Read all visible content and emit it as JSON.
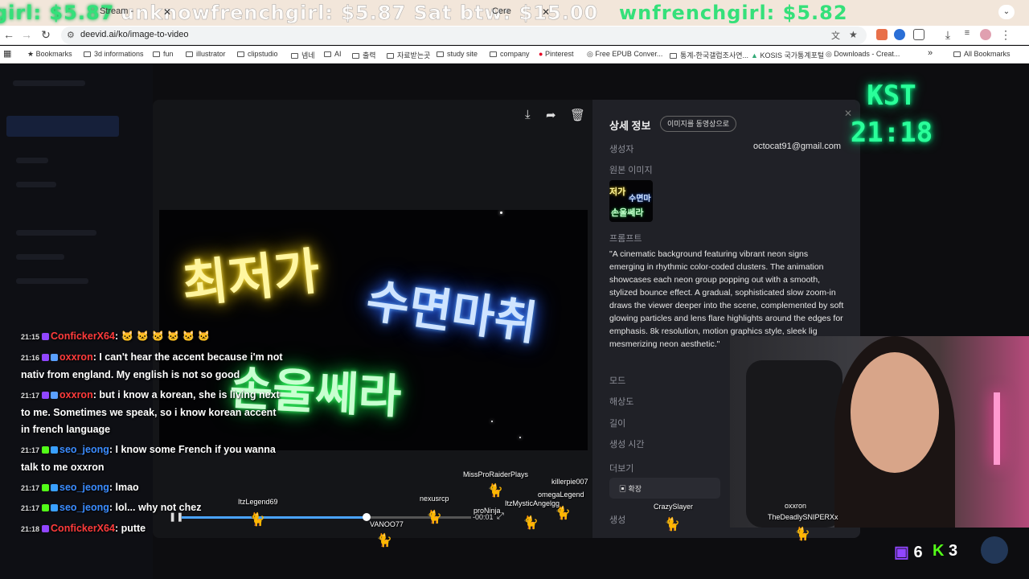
{
  "tabstrip": {
    "ticker_1": "girl: $5.87",
    "ticker_2": "unknowfrenchgirl: $5.87 Sat btw: $15.00",
    "ticker_3": "wnfrenchgirl: $5.82",
    "tab_fragments": [
      "Stream -",
      "Cere"
    ]
  },
  "address_bar": {
    "url": "deevid.ai/ko/image-to-video"
  },
  "bookmarks": [
    "Bookmarks",
    "3d informations",
    "fun",
    "illustrator",
    "clipstudio",
    "넴네",
    "AI",
    "출력",
    "자료받는곳",
    "study site",
    "company",
    "Pinterest",
    "Free EPUB Conver...",
    "통계-한국갤럽조사연...",
    "KOSIS 국가통계포털",
    "Downloads - Creat...",
    "All Bookmarks"
  ],
  "video": {
    "neon_1": "최저가",
    "neon_2": "수면마취",
    "neon_3": "손울쎄라",
    "time_remaining": "-00:01"
  },
  "details": {
    "title": "상세 정보",
    "convert_button": "이미지를 동영상으로",
    "creator_label": "생성자",
    "creator_value": "octocat91@gmail.com",
    "source_image_label": "원본 이미지",
    "thumb_1": "저가",
    "thumb_2": "수면마",
    "thumb_3": "손울쎄라",
    "prompt_label": "프롬프트",
    "prompt_text": "\"A cinematic background featuring vibrant neon signs emerging in rhythmic color-coded clusters. The animation showcases each neon group popping out with a smooth, stylized bounce effect. A gradual, sophisticated slow zoom-in draws the viewer deeper into the scene, complemented by soft glowing particles and lens flare highlights around the edges for emphasis. 8k resolution, motion graphics style, sleek lig mesmerizing neon aesthetic.\"",
    "mode_label": "모드",
    "resolution_label": "해상도",
    "length_label": "길이",
    "created_time_label": "생성 시간",
    "more_label": "더보기",
    "expand_button": "확장",
    "generate_label": "생성"
  },
  "chat": [
    {
      "time": "21:15",
      "user": "ConfickerX64",
      "text": ": 🐱 🐱 🐱 🐱 🐱 🐱",
      "color": "red"
    },
    {
      "time": "21:16",
      "user": "oxxron",
      "text": ": I can't hear the accent because i'm not nativ from england. My english is not so good",
      "color": "red"
    },
    {
      "time": "21:17",
      "user": "oxxron",
      "text": ": but i know a korean, she is living next to me. Sometimes we speak, so i know korean accent in french language",
      "color": "red"
    },
    {
      "time": "21:17",
      "user": "seo_jeong",
      "text": ": I know some French if you wanna talk to me oxxron",
      "color": "blue"
    },
    {
      "time": "21:17",
      "user": "seo_jeong",
      "text": ": lmao",
      "color": "blue"
    },
    {
      "time": "21:17",
      "user": "seo_jeong",
      "text": ": lol... why not chez",
      "color": "blue"
    },
    {
      "time": "21:18",
      "user": "ConfickerX64",
      "text": ": putte",
      "color": "red"
    }
  ],
  "pets": [
    "MissProRaiderPlays",
    "killerpie007",
    "omegaLegend",
    "nexusrcp",
    "ItzLegend69",
    "proNinja",
    "ItzMysticAngelgg",
    "VANOO77",
    "CrazySlayer",
    "oxxron",
    "TheDeadlySNIPERXx"
  ],
  "clock": {
    "line1": "KST",
    "line2": "21:18"
  },
  "counters": {
    "twitch": "6",
    "kick": "3"
  },
  "colors": {
    "accent_green": "#2aff9a",
    "chat_red": "#ff3b3b",
    "chat_blue": "#3b8cff",
    "progress": "#4aa3ff"
  },
  "playback": {
    "progress": 0.64
  }
}
